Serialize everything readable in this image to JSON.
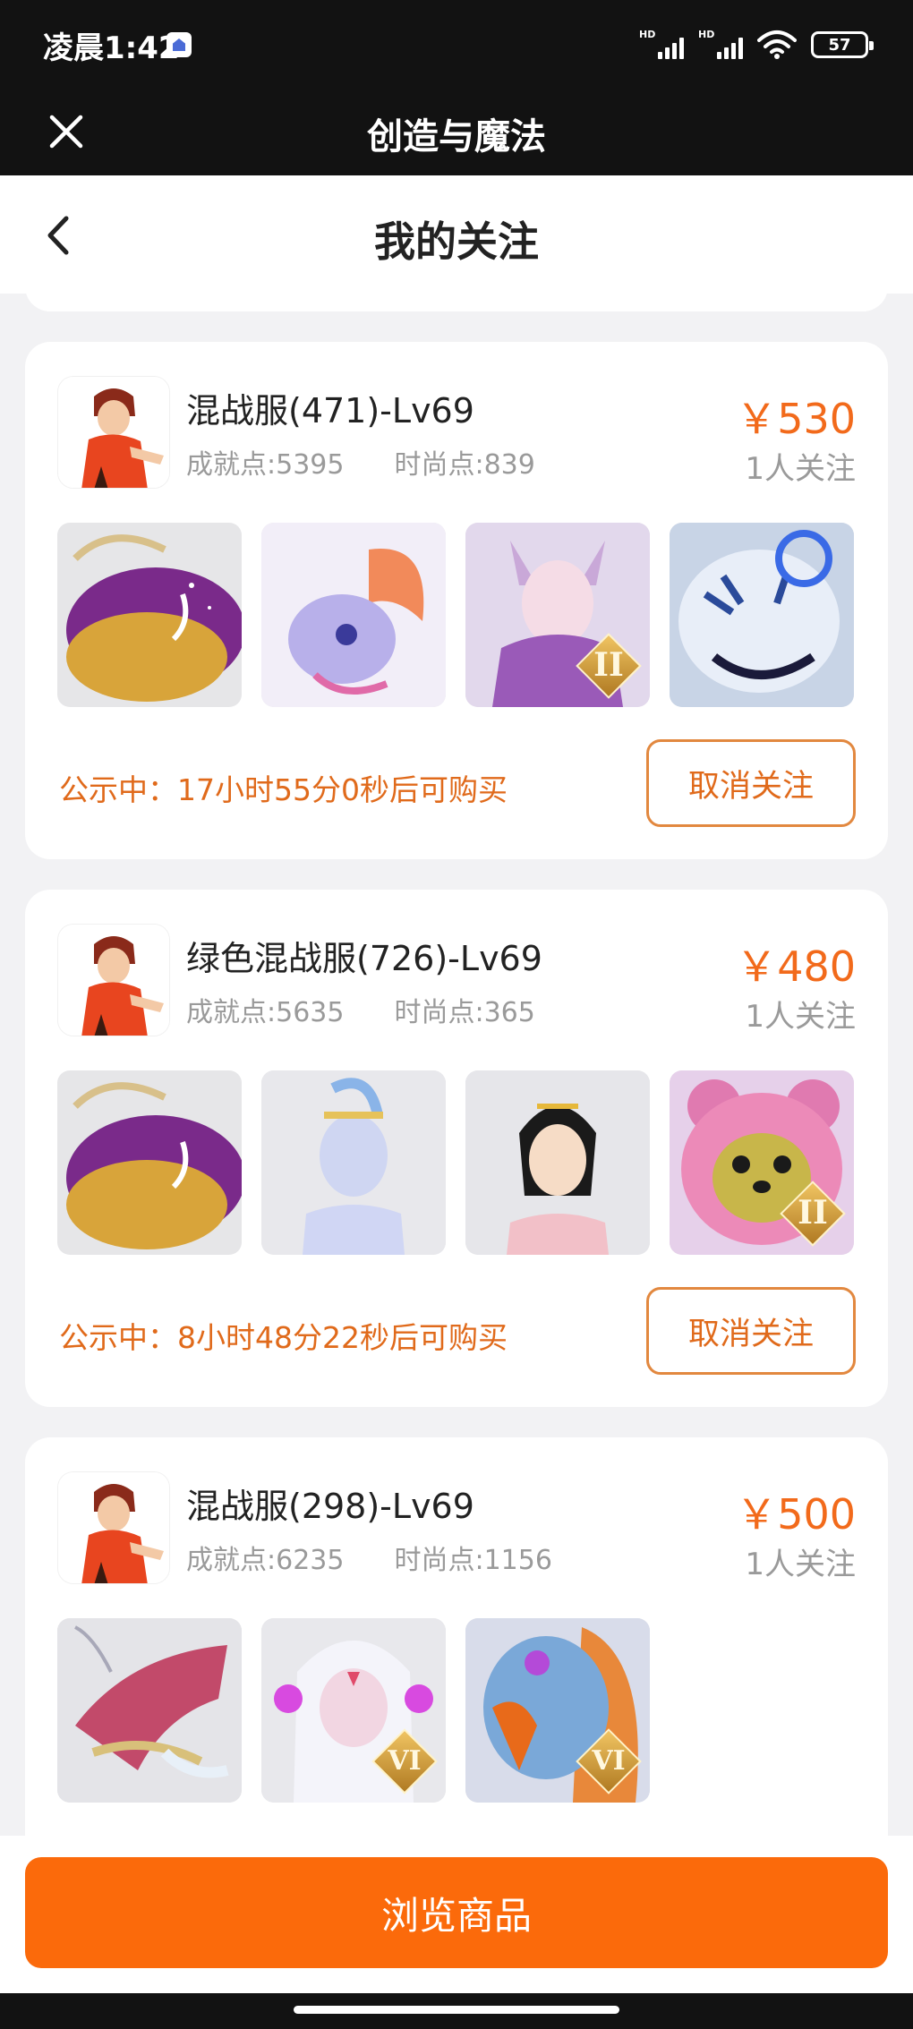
{
  "status_bar": {
    "time": "凌晨1:42",
    "battery": "57",
    "signal_label": "HD"
  },
  "app_bar": {
    "title": "创造与魔法"
  },
  "page": {
    "title": "我的关注"
  },
  "cards": [
    {
      "name": "混战服(471)-Lv69",
      "achievement": "成就点:5395",
      "fashion": "时尚点:839",
      "price": "￥530",
      "follows": "1人关注",
      "items": [
        {
          "icon": "whale-mount-icon",
          "rank": ""
        },
        {
          "icon": "dragon-pet-icon",
          "rank": ""
        },
        {
          "icon": "fox-girl-icon",
          "rank": "II"
        },
        {
          "icon": "white-tiger-icon",
          "rank": ""
        }
      ],
      "notice": "公示中：17小时55分0秒后可购买",
      "action": "取消关注"
    },
    {
      "name": "绿色混战服(726)-Lv69",
      "achievement": "成就点:5635",
      "fashion": "时尚点:365",
      "price": "￥480",
      "follows": "1人关注",
      "items": [
        {
          "icon": "whale-mount-icon",
          "rank": ""
        },
        {
          "icon": "blue-fairy-icon",
          "rank": ""
        },
        {
          "icon": "ancient-lady-icon",
          "rank": ""
        },
        {
          "icon": "pink-bear-icon",
          "rank": "II"
        }
      ],
      "notice": "公示中：8小时48分22秒后可购买",
      "action": "取消关注"
    },
    {
      "name": "混战服(298)-Lv69",
      "achievement": "成就点:6235",
      "fashion": "时尚点:1156",
      "price": "￥500",
      "follows": "1人关注",
      "items": [
        {
          "icon": "pink-dragon-icon",
          "rank": ""
        },
        {
          "icon": "white-spirit-icon",
          "rank": "VI"
        },
        {
          "icon": "phoenix-bird-icon",
          "rank": "VI"
        }
      ],
      "notice": "",
      "action": ""
    }
  ],
  "bottom": {
    "browse_label": "浏览商品"
  },
  "colors": {
    "accent": "#fb6a0b",
    "price": "#f26a1b",
    "notice": "#e06a1b",
    "dark_bar": "#121212"
  }
}
